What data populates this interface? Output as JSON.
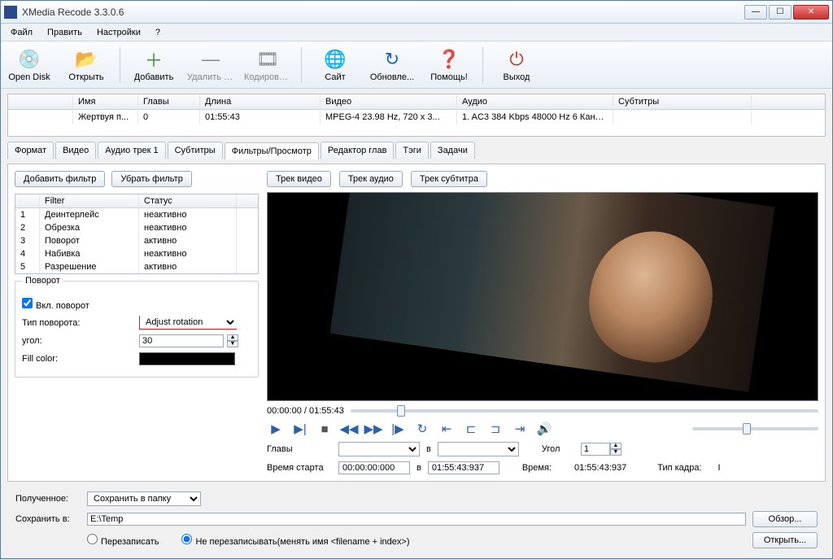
{
  "window": {
    "title": "XMedia Recode 3.3.0.6"
  },
  "menu": {
    "file": "Файл",
    "edit": "Править",
    "settings": "Настройки",
    "help": "?"
  },
  "toolbar": {
    "opendisk": "Open Disk",
    "open": "Открыть",
    "add": "Добавить",
    "remove": "Удалить ра...",
    "encode": "Кодировать",
    "site": "Сайт",
    "update": "Обновле...",
    "assist": "Помощь!",
    "exit": "Выход"
  },
  "filegrid": {
    "headers": {
      "name": "Имя",
      "chapters": "Главы",
      "length": "Длина",
      "video": "Видео",
      "audio": "Аудио",
      "subs": "Субтитры"
    },
    "row": {
      "name": "Жертвуя п...",
      "chapters": "0",
      "length": "01:55:43",
      "video": "MPEG-4  23.98 Hz,  720 x 3...",
      "audio": "1. AC3  384 Kbps  48000 Hz  6 Канал...",
      "subs": ""
    }
  },
  "tabs": {
    "format": "Формат",
    "video": "Видео",
    "audio": "Аудио трек 1",
    "subs": "Субтитры",
    "filters": "Фильтры/Просмотр",
    "chapters": "Редактор глав",
    "tags": "Тэги",
    "tasks": "Задачи"
  },
  "filter_panel": {
    "add_filter": "Добавить фильтр",
    "remove_filter": "Убрать фильтр",
    "headers": {
      "filter": "Filter",
      "status": "Статус"
    },
    "rows": [
      {
        "n": "1",
        "f": "Деинтерлейс",
        "s": "неактивно"
      },
      {
        "n": "2",
        "f": "Обрезка",
        "s": "неактивно"
      },
      {
        "n": "3",
        "f": "Поворот",
        "s": "активно"
      },
      {
        "n": "4",
        "f": "Набивка",
        "s": "неактивно"
      },
      {
        "n": "5",
        "f": "Разрешение",
        "s": "активно"
      }
    ],
    "group_title": "Поворот",
    "enable_rotate": "Вкл. поворот",
    "rotate_type_label": "Тип поворота:",
    "rotate_type_value": "Adjust rotation",
    "angle_label": "угол:",
    "angle_value": "30",
    "fillcolor_label": "Fill color:"
  },
  "preview": {
    "track_video": "Трек видео",
    "track_audio": "Трек аудио",
    "track_sub": "Трек субтитра",
    "time": "00:00:00 / 01:55:43",
    "chapters_label": "Главы",
    "in_label": "в",
    "angle_label": "Угол",
    "angle_value": "1",
    "start_label": "Время старта",
    "start_value": "00:00:00:000",
    "end_value": "01:55:43:937",
    "time_label": "Время:",
    "time_value": "01:55:43:937",
    "frame_label": "Тип кадра:",
    "frame_value": "I"
  },
  "footer": {
    "out_label": "Полученное:",
    "out_value": "Сохранить в папку",
    "save_label": "Сохранить в:",
    "path": "E:\\Temp",
    "browse": "Обзор...",
    "open": "Открыть...",
    "overwrite": "Перезаписать",
    "no_overwrite": "Не перезаписывать(менять имя <filename + index>)"
  }
}
